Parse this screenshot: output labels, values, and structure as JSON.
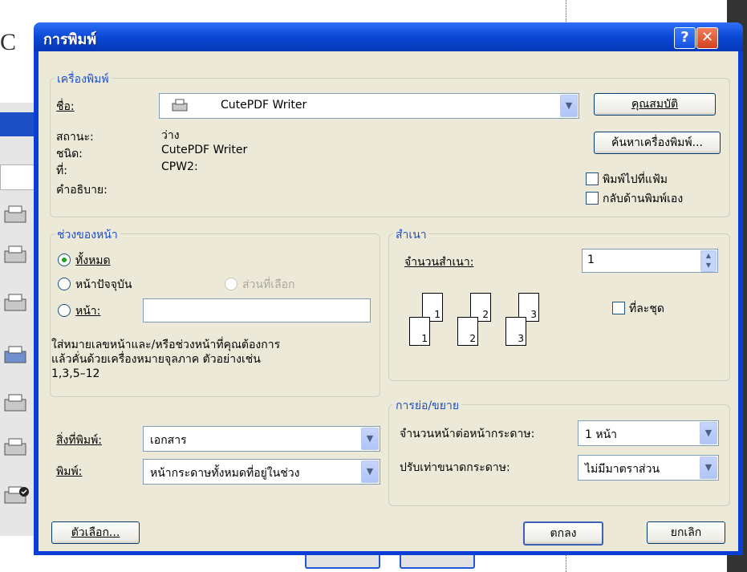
{
  "dialog": {
    "title": "การพิมพ์",
    "help_label": "?",
    "close_label": "✕"
  },
  "printer": {
    "legend": "เครื่องพิมพ์",
    "name_label": "ชื่อ:",
    "name_value": "CutePDF Writer",
    "properties_button": "คุณสมบัติ",
    "find_printer_button": "ค้นหาเครื่องพิมพ์...",
    "status_label": "สถานะ:",
    "status_value": "ว่าง",
    "type_label": "ชนิด:",
    "type_value": "CutePDF Writer",
    "where_label": "ที่:",
    "where_value": "CPW2:",
    "comment_label": "คำอธิบาย:",
    "comment_value": "",
    "print_to_file_label": "พิมพ์ไปที่แฟ้ม",
    "manual_duplex_label": "กลับด้านพิมพ์เอง"
  },
  "page_range": {
    "legend": "ช่วงของหน้า",
    "all_label": "ทั้งหมด",
    "current_label": "หน้าปัจจุบัน",
    "selection_label": "ส่วนที่เลือก",
    "pages_label": "หน้า:",
    "pages_value": "",
    "help_text_line1": "ใส่หมายเลขหน้าและ/หรือช่วงหน้าที่คุณต้องการ",
    "help_text_line2": "แล้วคั่นด้วยเครื่องหมายจุลภาค ตัวอย่างเช่น",
    "help_text_line3": "1,3,5–12"
  },
  "copies": {
    "legend": "สำเนา",
    "count_label": "จำนวนสำเนา:",
    "count_value": "1",
    "collate_label": "ที่ละชุด",
    "page_numbers": [
      "1",
      "2",
      "3"
    ]
  },
  "print_what": {
    "label": "สิ่งที่พิมพ์:",
    "value": "เอกสาร"
  },
  "print_pages": {
    "label": "พิมพ์:",
    "value": "หน้ากระดาษทั้งหมดที่อยู่ในช่วง"
  },
  "zoom": {
    "legend": "การย่อ/ขยาย",
    "pages_per_sheet_label": "จำนวนหน้าต่อหน้ากระดาษ:",
    "pages_per_sheet_value": "1 หน้า",
    "scale_label": "ปรับเท่าขนาดกระดาษ:",
    "scale_value": "ไม่มีมาตราส่วน"
  },
  "footer": {
    "options_button": "ตัวเลือก...",
    "ok_button": "ตกลง",
    "cancel_button": "ยกเลิก"
  },
  "background": {
    "doc_letter": "C"
  }
}
